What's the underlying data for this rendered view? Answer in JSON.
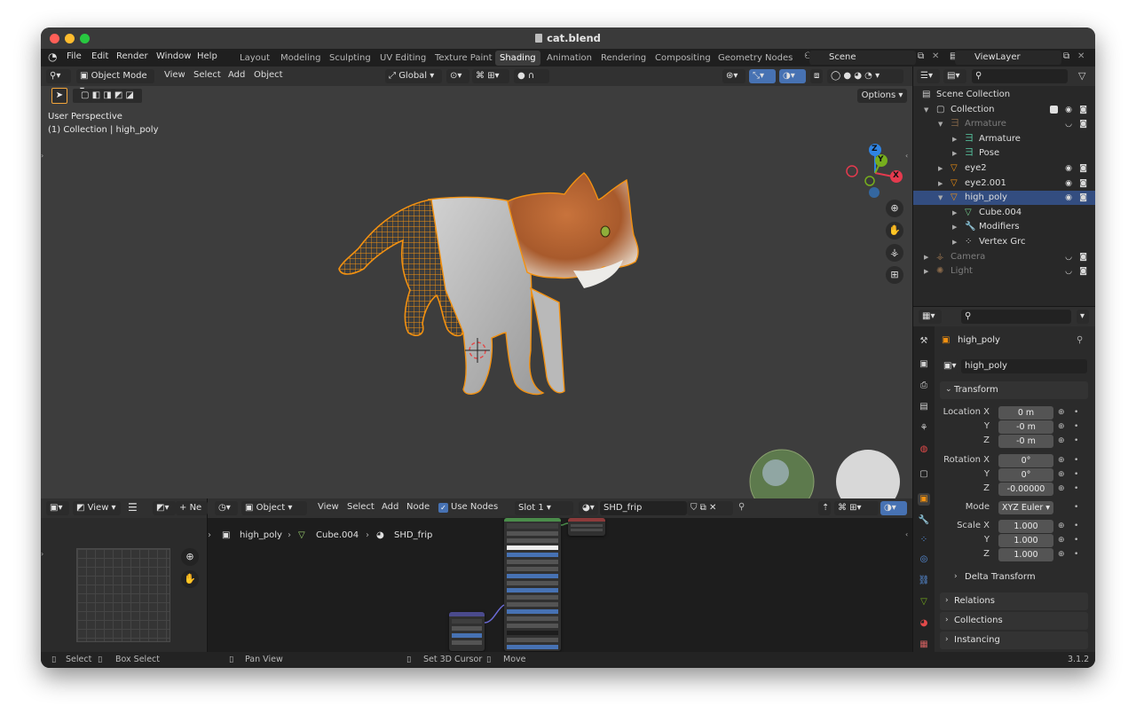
{
  "window": {
    "title": "cat.blend"
  },
  "menu": {
    "items": [
      "File",
      "Edit",
      "Render",
      "Window",
      "Help"
    ]
  },
  "workspaces": [
    "Layout",
    "Modeling",
    "Sculpting",
    "UV Editing",
    "Texture Paint",
    "Shading",
    "Animation",
    "Rendering",
    "Compositing",
    "Geometry Nodes"
  ],
  "active_workspace": "Shading",
  "scene": {
    "name": "Scene"
  },
  "view_layer": {
    "name": "ViewLayer"
  },
  "viewport": {
    "mode": "Object Mode",
    "menu": [
      "View",
      "Select",
      "Add",
      "Object"
    ],
    "transform_orientation": "Global",
    "options_label": "Options",
    "overlay_line1": "User Perspective",
    "overlay_line2": "(1) Collection | high_poly",
    "gizmo_axes": {
      "x": "X",
      "y": "Y",
      "z": "Z"
    }
  },
  "outliner": {
    "rows": [
      {
        "label": "Scene Collection",
        "indent": 0,
        "icon": "scene-collection-icon"
      },
      {
        "label": "Collection",
        "indent": 1,
        "icon": "collection-icon"
      },
      {
        "label": "Armature",
        "indent": 2,
        "icon": "armature-icon",
        "dim": true
      },
      {
        "label": "Armature",
        "indent": 3,
        "icon": "armature-data-icon"
      },
      {
        "label": "Pose",
        "indent": 3,
        "icon": "pose-icon"
      },
      {
        "label": "eye2",
        "indent": 2,
        "icon": "mesh-object-icon"
      },
      {
        "label": "eye2.001",
        "indent": 2,
        "icon": "mesh-object-icon"
      },
      {
        "label": "high_poly",
        "indent": 2,
        "icon": "mesh-object-icon",
        "selected": true
      },
      {
        "label": "Cube.004",
        "indent": 3,
        "icon": "mesh-data-icon"
      },
      {
        "label": "Modifiers",
        "indent": 3,
        "icon": "modifier-icon"
      },
      {
        "label": "Vertex Grc",
        "indent": 3,
        "icon": "vertex-group-icon"
      },
      {
        "label": "Camera",
        "indent": 1,
        "icon": "camera-icon",
        "dim": true
      },
      {
        "label": "Light",
        "indent": 1,
        "icon": "light-icon",
        "dim": true
      }
    ]
  },
  "properties": {
    "object_name": "high_poly",
    "object_field": "high_poly",
    "transform_label": "Transform",
    "location": {
      "label": "Location X",
      "y_label": "Y",
      "z_label": "Z",
      "x": "0 m",
      "y": "-0 m",
      "z": "-0 m"
    },
    "rotation": {
      "label": "Rotation X",
      "y_label": "Y",
      "z_label": "Z",
      "x": "0°",
      "y": "0°",
      "z": "-0.00000"
    },
    "mode": {
      "label": "Mode",
      "value": "XYZ Euler"
    },
    "scale": {
      "label": "Scale X",
      "y_label": "Y",
      "z_label": "Z",
      "x": "1.000",
      "y": "1.000",
      "z": "1.000"
    },
    "delta_transform": "Delta Transform",
    "panels": [
      "Relations",
      "Collections",
      "Instancing"
    ]
  },
  "image_editor": {
    "view_label": "View",
    "new_label": "Ne"
  },
  "node_editor": {
    "object_label": "Object",
    "menu": [
      "View",
      "Select",
      "Add",
      "Node"
    ],
    "use_nodes_label": "Use Nodes",
    "slot": "Slot 1",
    "material": "SHD_frip",
    "breadcrumb": [
      "high_poly",
      "Cube.004",
      "SHD_frip"
    ]
  },
  "status_bar": {
    "items": [
      "Select",
      "Box Select",
      "Pan View",
      "Set 3D Cursor",
      "Move"
    ],
    "version": "3.1.2"
  },
  "colors": {
    "selection_orange": "#f29111",
    "accent_blue": "#4772b3",
    "viewport_bg": "#3d3d3d",
    "axis_x": "#e43a4e",
    "axis_y": "#76ae1d",
    "axis_z": "#2f84e3"
  }
}
